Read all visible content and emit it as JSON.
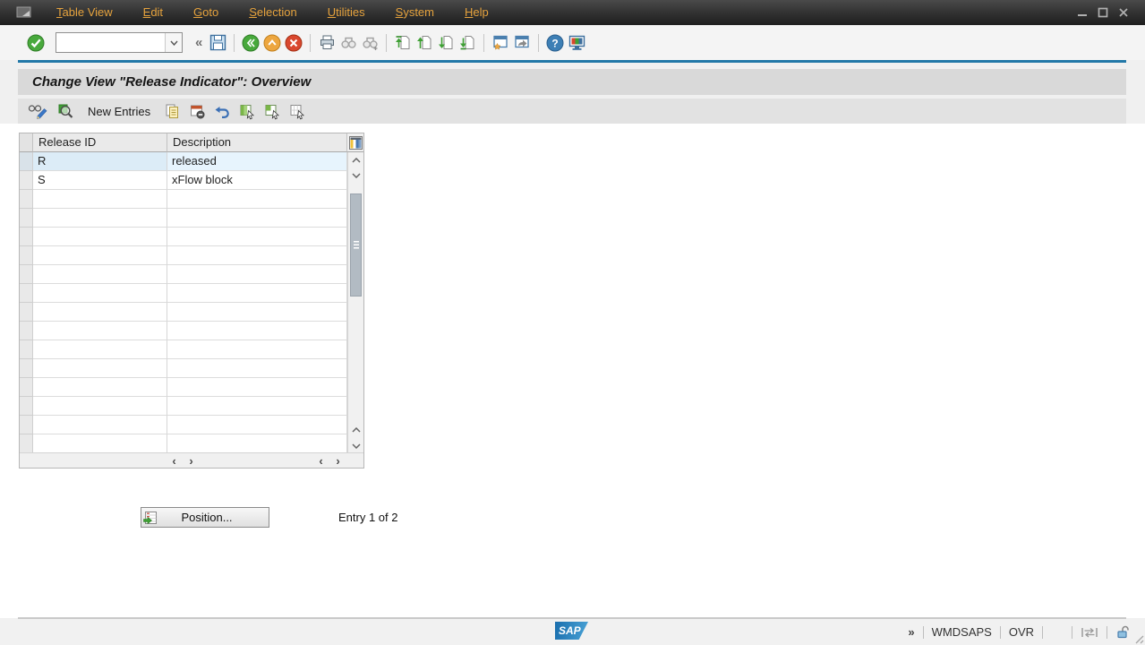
{
  "menu_bar": {
    "items": [
      {
        "label": "Table View"
      },
      {
        "label": "Edit"
      },
      {
        "label": "Goto"
      },
      {
        "label": "Selection"
      },
      {
        "label": "Utilities"
      },
      {
        "label": "System"
      },
      {
        "label": "Help"
      }
    ]
  },
  "toolbar": {
    "command_value": ""
  },
  "title": "Change View \"Release Indicator\": Overview",
  "app_toolbar": {
    "new_entries": "New Entries"
  },
  "table": {
    "columns": [
      "Release ID",
      "Description"
    ],
    "rows": [
      {
        "release_id": "R",
        "description": "released"
      },
      {
        "release_id": "S",
        "description": "xFlow block"
      }
    ],
    "empty_row_count": 14
  },
  "footer": {
    "position_button": "Position...",
    "entry_status": "Entry 1 of 2"
  },
  "status_bar": {
    "overflow": "»",
    "system_id": "WMDSAPS",
    "input_mode": "OVR",
    "logo": "SAP"
  },
  "icons": {
    "collapse": "«",
    "scroll_left": "‹",
    "scroll_right": "›"
  },
  "colors": {
    "accent_line": "#2278a8",
    "menu_text": "#e5a23d",
    "selected_row_bg": "#e7f4fd",
    "sap_blue": "#1a6fae"
  }
}
